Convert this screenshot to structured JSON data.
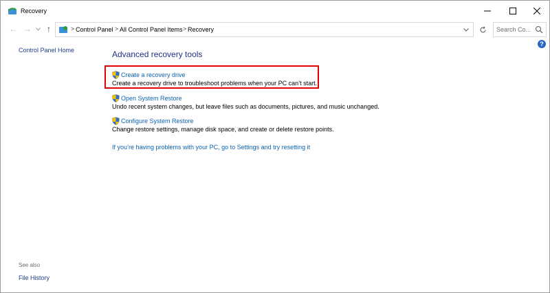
{
  "window": {
    "title": "Recovery",
    "icon": "recovery-icon"
  },
  "titlebar": {
    "minimize_icon": "minimize-icon",
    "maximize_icon": "maximize-icon",
    "close_icon": "close-icon"
  },
  "address": {
    "crumbs": [
      "Control Panel",
      "All Control Panel Items",
      "Recovery"
    ],
    "separator": ">"
  },
  "search": {
    "placeholder": "Search Co..."
  },
  "left_pane": {
    "home_link": "Control Panel Home",
    "see_also_label": "See also",
    "see_also_links": [
      "File History"
    ]
  },
  "main": {
    "heading": "Advanced recovery tools",
    "tasks": [
      {
        "link": "Create a recovery drive",
        "description": "Create a recovery drive to troubleshoot problems when your PC can’t start.",
        "icon": "shield-icon",
        "highlighted": true
      },
      {
        "link": "Open System Restore",
        "description": "Undo recent system changes, but leave files such as documents, pictures, and music unchanged.",
        "icon": "shield-icon"
      },
      {
        "link": "Configure System Restore",
        "description": "Change restore settings, manage disk space, and create or delete restore points.",
        "icon": "shield-icon"
      }
    ],
    "reset_link": "If you’re having problems with your PC, go to Settings and try resetting it"
  },
  "colors": {
    "heading": "#1e3287",
    "link": "#0a62b4",
    "highlight_border": "#e00000",
    "help_icon": "#2b67c4"
  },
  "help": {
    "symbol": "?"
  }
}
